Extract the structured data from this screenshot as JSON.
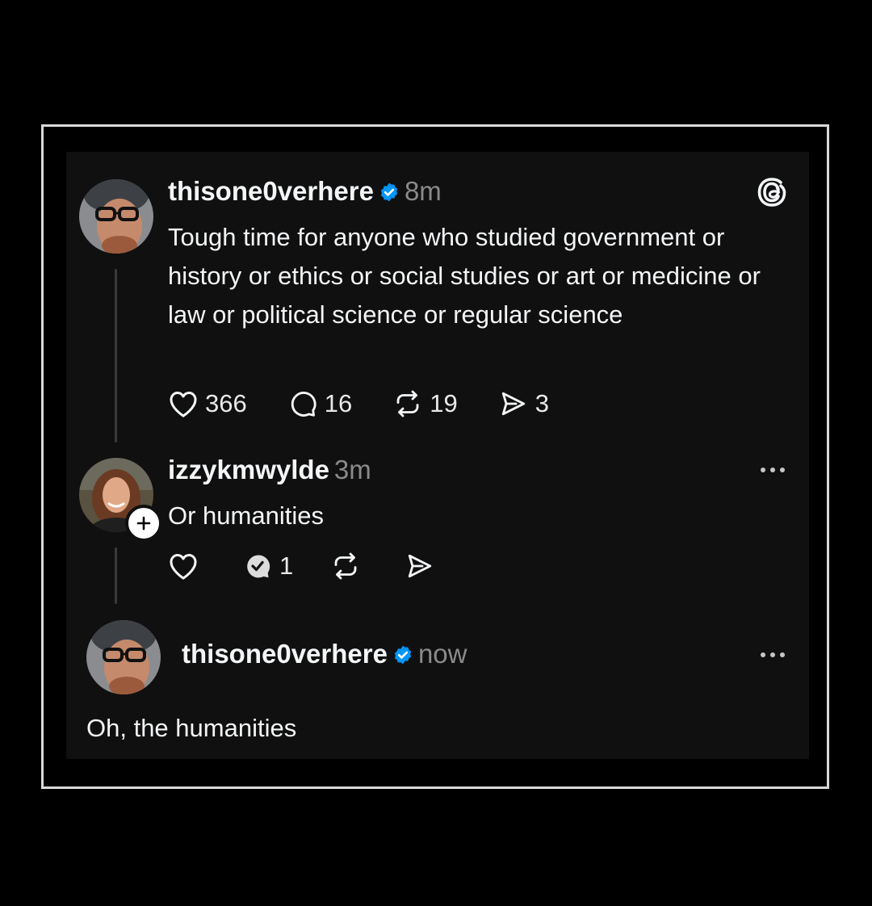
{
  "post": {
    "username": "thisone0verhere",
    "time": "8m",
    "text": "Tough time for anyone who studied government or history or ethics or social studies or art or medicine or law or political science or regular science",
    "likes": "366",
    "replies": "16",
    "reposts": "19",
    "shares": "3"
  },
  "reply": {
    "username": "izzykmwylde",
    "time": "3m",
    "text": "Or humanities",
    "replies": "1"
  },
  "response": {
    "username": "thisone0verhere",
    "time": "now",
    "text": "Oh, the humanities"
  },
  "colors": {
    "background": "#101010",
    "verified": "#0095f6",
    "muted": "#8a8a8a"
  }
}
